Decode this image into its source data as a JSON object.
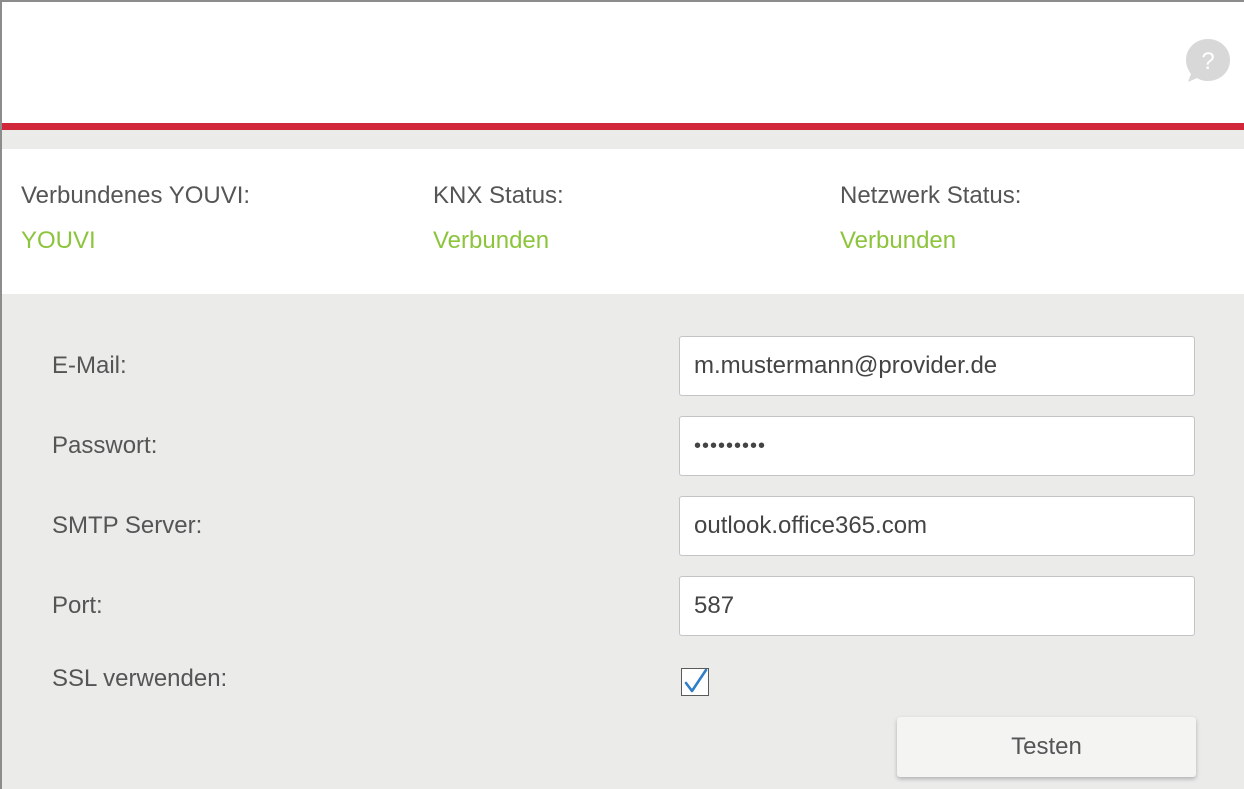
{
  "header": {
    "help_icon": "help-question-icon",
    "help_glyph": "?",
    "accent_color": "#d0273a"
  },
  "status": {
    "connected_youvi": {
      "label": "Verbundenes YOUVI:",
      "value": "YOUVI"
    },
    "knx": {
      "label": "KNX Status:",
      "value": "Verbunden"
    },
    "network": {
      "label": "Netzwerk Status:",
      "value": "Verbunden"
    },
    "value_color": "#8cc43c"
  },
  "form": {
    "email": {
      "label": "E-Mail:",
      "value": "m.mustermann@provider.de"
    },
    "password": {
      "label": "Passwort:",
      "value": "•••••••••"
    },
    "smtp": {
      "label": "SMTP Server:",
      "value": "outlook.office365.com"
    },
    "port": {
      "label": "Port:",
      "value": "587"
    },
    "ssl": {
      "label": "SSL verwenden:",
      "checked": true,
      "icon": "checkmark-icon"
    },
    "test_button": "Testen"
  }
}
